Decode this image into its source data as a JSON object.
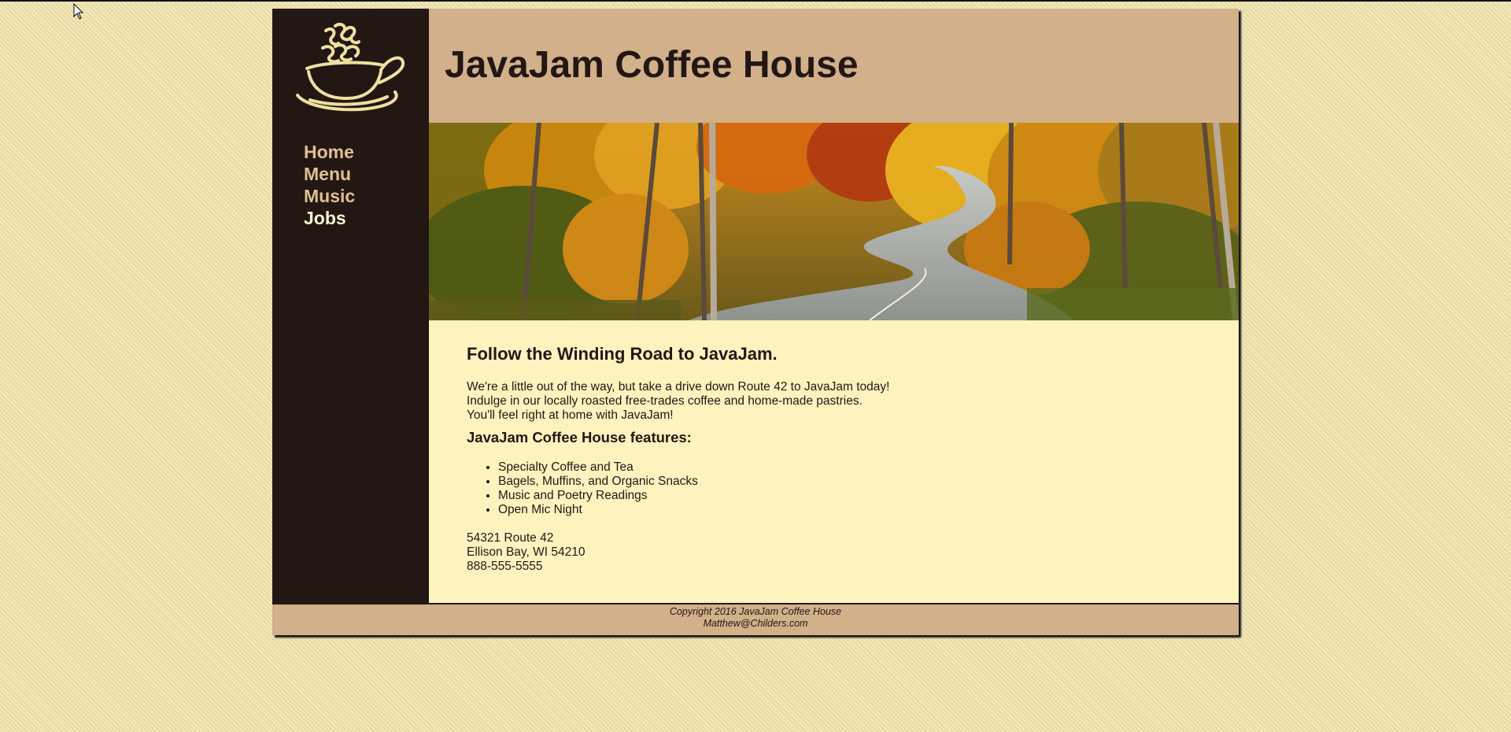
{
  "site": {
    "title": "JavaJam Coffee House"
  },
  "nav": {
    "items": [
      {
        "label": "Home"
      },
      {
        "label": "Menu"
      },
      {
        "label": "Music"
      },
      {
        "label": "Jobs"
      }
    ],
    "current": "Jobs"
  },
  "main": {
    "heading": "Follow the Winding Road to JavaJam.",
    "intro_lines": [
      "We're a little out of the way, but take a drive down Route 42 to JavaJam today!",
      "Indulge in our locally roasted free-trades coffee and home-made pastries.",
      "You'll feel right at home with JavaJam!"
    ],
    "features_heading": "JavaJam Coffee House features:",
    "features": [
      "Specialty Coffee and Tea",
      "Bagels, Muffins, and Organic Snacks",
      "Music and Poetry Readings",
      "Open Mic Night"
    ],
    "address_lines": [
      "54321 Route 42",
      "Ellison Bay, WI 54210",
      "888-555-5555"
    ]
  },
  "footer": {
    "copyright": "Copyright 2016 JavaJam Coffee House",
    "email": "Matthew@Childers.com"
  },
  "icons": {
    "logo": "coffee-cup-logo-icon",
    "cursor": "mouse-pointer-icon"
  },
  "colors": {
    "page_background": "#f3e7b6",
    "sidebar": "#231714",
    "header": "#d2b08a",
    "content": "#fdf3bf",
    "nav_link": "#dfc091",
    "nav_current": "#fdf3d1"
  }
}
